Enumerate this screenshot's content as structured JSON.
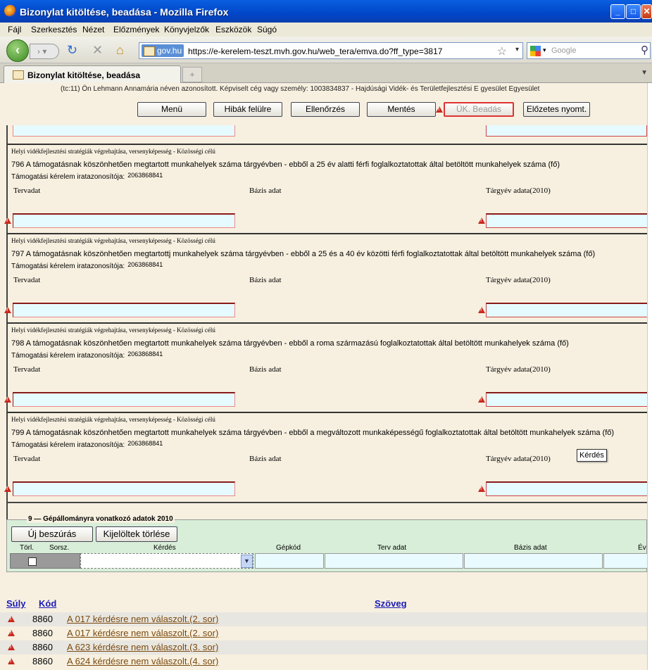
{
  "window": {
    "title": "Bizonylat kitöltése, beadása - Mozilla Firefox"
  },
  "menu": [
    "Fájl",
    "Szerkesztés",
    "Nézet",
    "Előzmények",
    "Könyvjelzők",
    "Eszközök",
    "Súgó"
  ],
  "nav": {
    "site": "gov.hu",
    "url": "https://e-kerelem-teszt.mvh.gov.hu/web_tera/emva.do?ff_type=3817",
    "search_placeholder": "Google"
  },
  "tab": {
    "label": "Bizonylat kitöltése, beadása",
    "new_tab": "+"
  },
  "header": {
    "identity": "(tc:11) Ön Lehmann Annamária néven azonosított.  Képviselt cég vagy személy: 1003834837 - Hajdúsági Vidék- és Területfejlesztési E gyesület Egyesület"
  },
  "buttons": {
    "menu": "Menü",
    "errors": "Hibák felülre",
    "check": "Ellenőrzés",
    "save": "Mentés",
    "submit": "ÜK. Beadás",
    "preview": "Előzetes nyomt."
  },
  "sections": [
    {
      "title": "Helyi vidékfejlesztési stratégiák végrehajtása, versenyképesség - Közösségi célú",
      "question": "796  A támogatásnak köszönhetően megtartott munkahelyek száma tárgyévben - ebből a 25 év alatti férfi foglalkoztatottak által betöltött munkahelyek száma (fő)",
      "id_label": "Támogatási kérelem iratazonosítója:",
      "id_value": "2063868841",
      "col1": "Tervadat",
      "col2": "Bázis adat",
      "col3": "Tárgyév adata(2010)"
    },
    {
      "title": "Helyi vidékfejlesztési stratégiák végrehajtása, versenyképesség - Közösségi célú",
      "question": "797  A támogatásnak köszönhetően megtartottj munkahelyek száma tárgyévben - ebből a 25 és a 40 év közötti férfi foglalkoztatottak által betöltött  munkahelyek száma (fő)",
      "id_label": "Támogatási kérelem iratazonosítója:",
      "id_value": "2063868841",
      "col1": "Tervadat",
      "col2": "Bázis adat",
      "col3": "Tárgyév adata(2010)"
    },
    {
      "title": "Helyi vidékfejlesztési stratégiák végrehajtása, versenyképesség - Közösségi célú",
      "question": "798  A támogatásnak köszönhetően megtartott munkahelyek száma tárgyévben - ebből a roma származású  foglalkoztatottak által betöltött munkahelyek száma (fő)",
      "id_label": "Támogatási kérelem iratazonosítója:",
      "id_value": "2063868841",
      "col1": "Tervadat",
      "col2": "Bázis adat",
      "col3": "Tárgyév adata(2010)"
    },
    {
      "title": "Helyi vidékfejlesztési stratégiák végrehajtása, versenyképesség - Közösségi célú",
      "question": "799  A támogatásnak köszönhetően megtartott munkahelyek száma tárgyévben - ebből a megváltozott munkaképességű foglalkoztatottak által betöltött munkahelyek száma (fő)",
      "id_label": "Támogatási kérelem iratazonosítója:",
      "id_value": "2063868841",
      "col1": "Tervadat",
      "col2": "Bázis adat",
      "col3": "Tárgyév adata(2010)"
    }
  ],
  "tooltip": "Kérdés",
  "machinery": {
    "number": "9",
    "title": "Gépállományra vonatkozó adatok 2010",
    "new_button": "Új beszúrás",
    "delete_button": "Kijelöltek törlése",
    "columns": [
      "Törl.",
      "Sorsz.",
      "Kérdés",
      "Gépkód",
      "Terv adat",
      "Bázis adat",
      "Év"
    ]
  },
  "errors": {
    "headers": {
      "weight": "Súly",
      "code": "Kód",
      "text": "Szöveg"
    },
    "rows": [
      {
        "code": "8860",
        "text": "A 017 kérdésre nem válaszolt.(2. sor)"
      },
      {
        "code": "8860",
        "text": "A 017 kérdésre nem válaszolt.(2. sor)"
      },
      {
        "code": "8860",
        "text": "A 623 kérdésre nem válaszolt.(3. sor)"
      },
      {
        "code": "8860",
        "text": "A 624 kérdésre nem válaszolt.(4. sor)"
      }
    ]
  },
  "colors": {
    "accent": "#0046c8",
    "error": "#c8281e",
    "input_bg": "#e6fbff",
    "page_bg": "#f7f0e0"
  }
}
